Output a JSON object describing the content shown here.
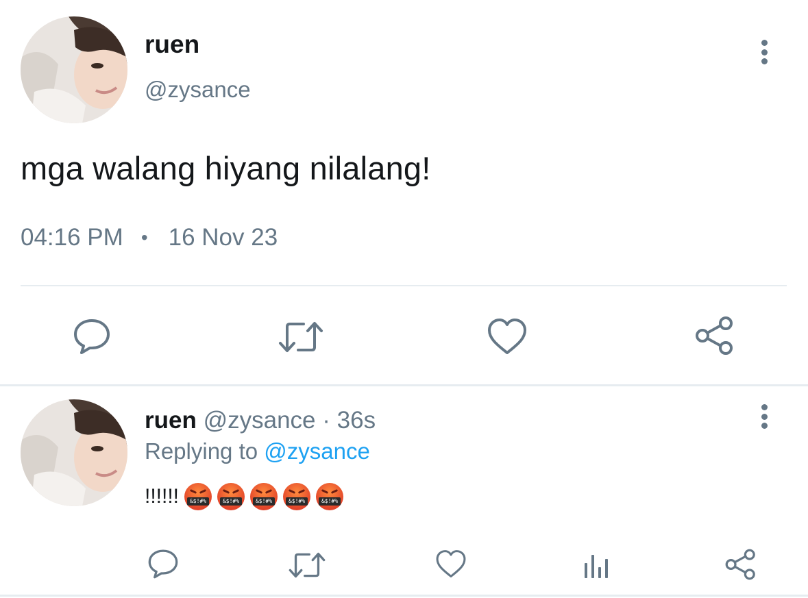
{
  "main_tweet": {
    "name": "ruen",
    "handle": "@zysance",
    "text": "mga walang hiyang nilalang!",
    "time": "04:16 PM",
    "separator": "•",
    "date": "16 Nov 23",
    "actions": [
      "reply-icon",
      "retweet-icon",
      "like-icon",
      "share-icon"
    ]
  },
  "reply_tweet": {
    "name": "ruen",
    "handle": "@zysance",
    "dot": "·",
    "age": "36s",
    "replying_label": "Replying to",
    "replying_to": "@zysance",
    "text": "!!!!!!",
    "emoji_count": 5,
    "emoji_symbol": "&$!#%",
    "actions": [
      "reply-icon",
      "retweet-icon",
      "like-icon",
      "analytics-icon",
      "share-icon"
    ]
  },
  "colors": {
    "text_primary": "#14171a",
    "text_secondary": "#657786",
    "link": "#1da1f2",
    "divider": "#e6ecf0",
    "emoji_face": "#e2442a"
  }
}
